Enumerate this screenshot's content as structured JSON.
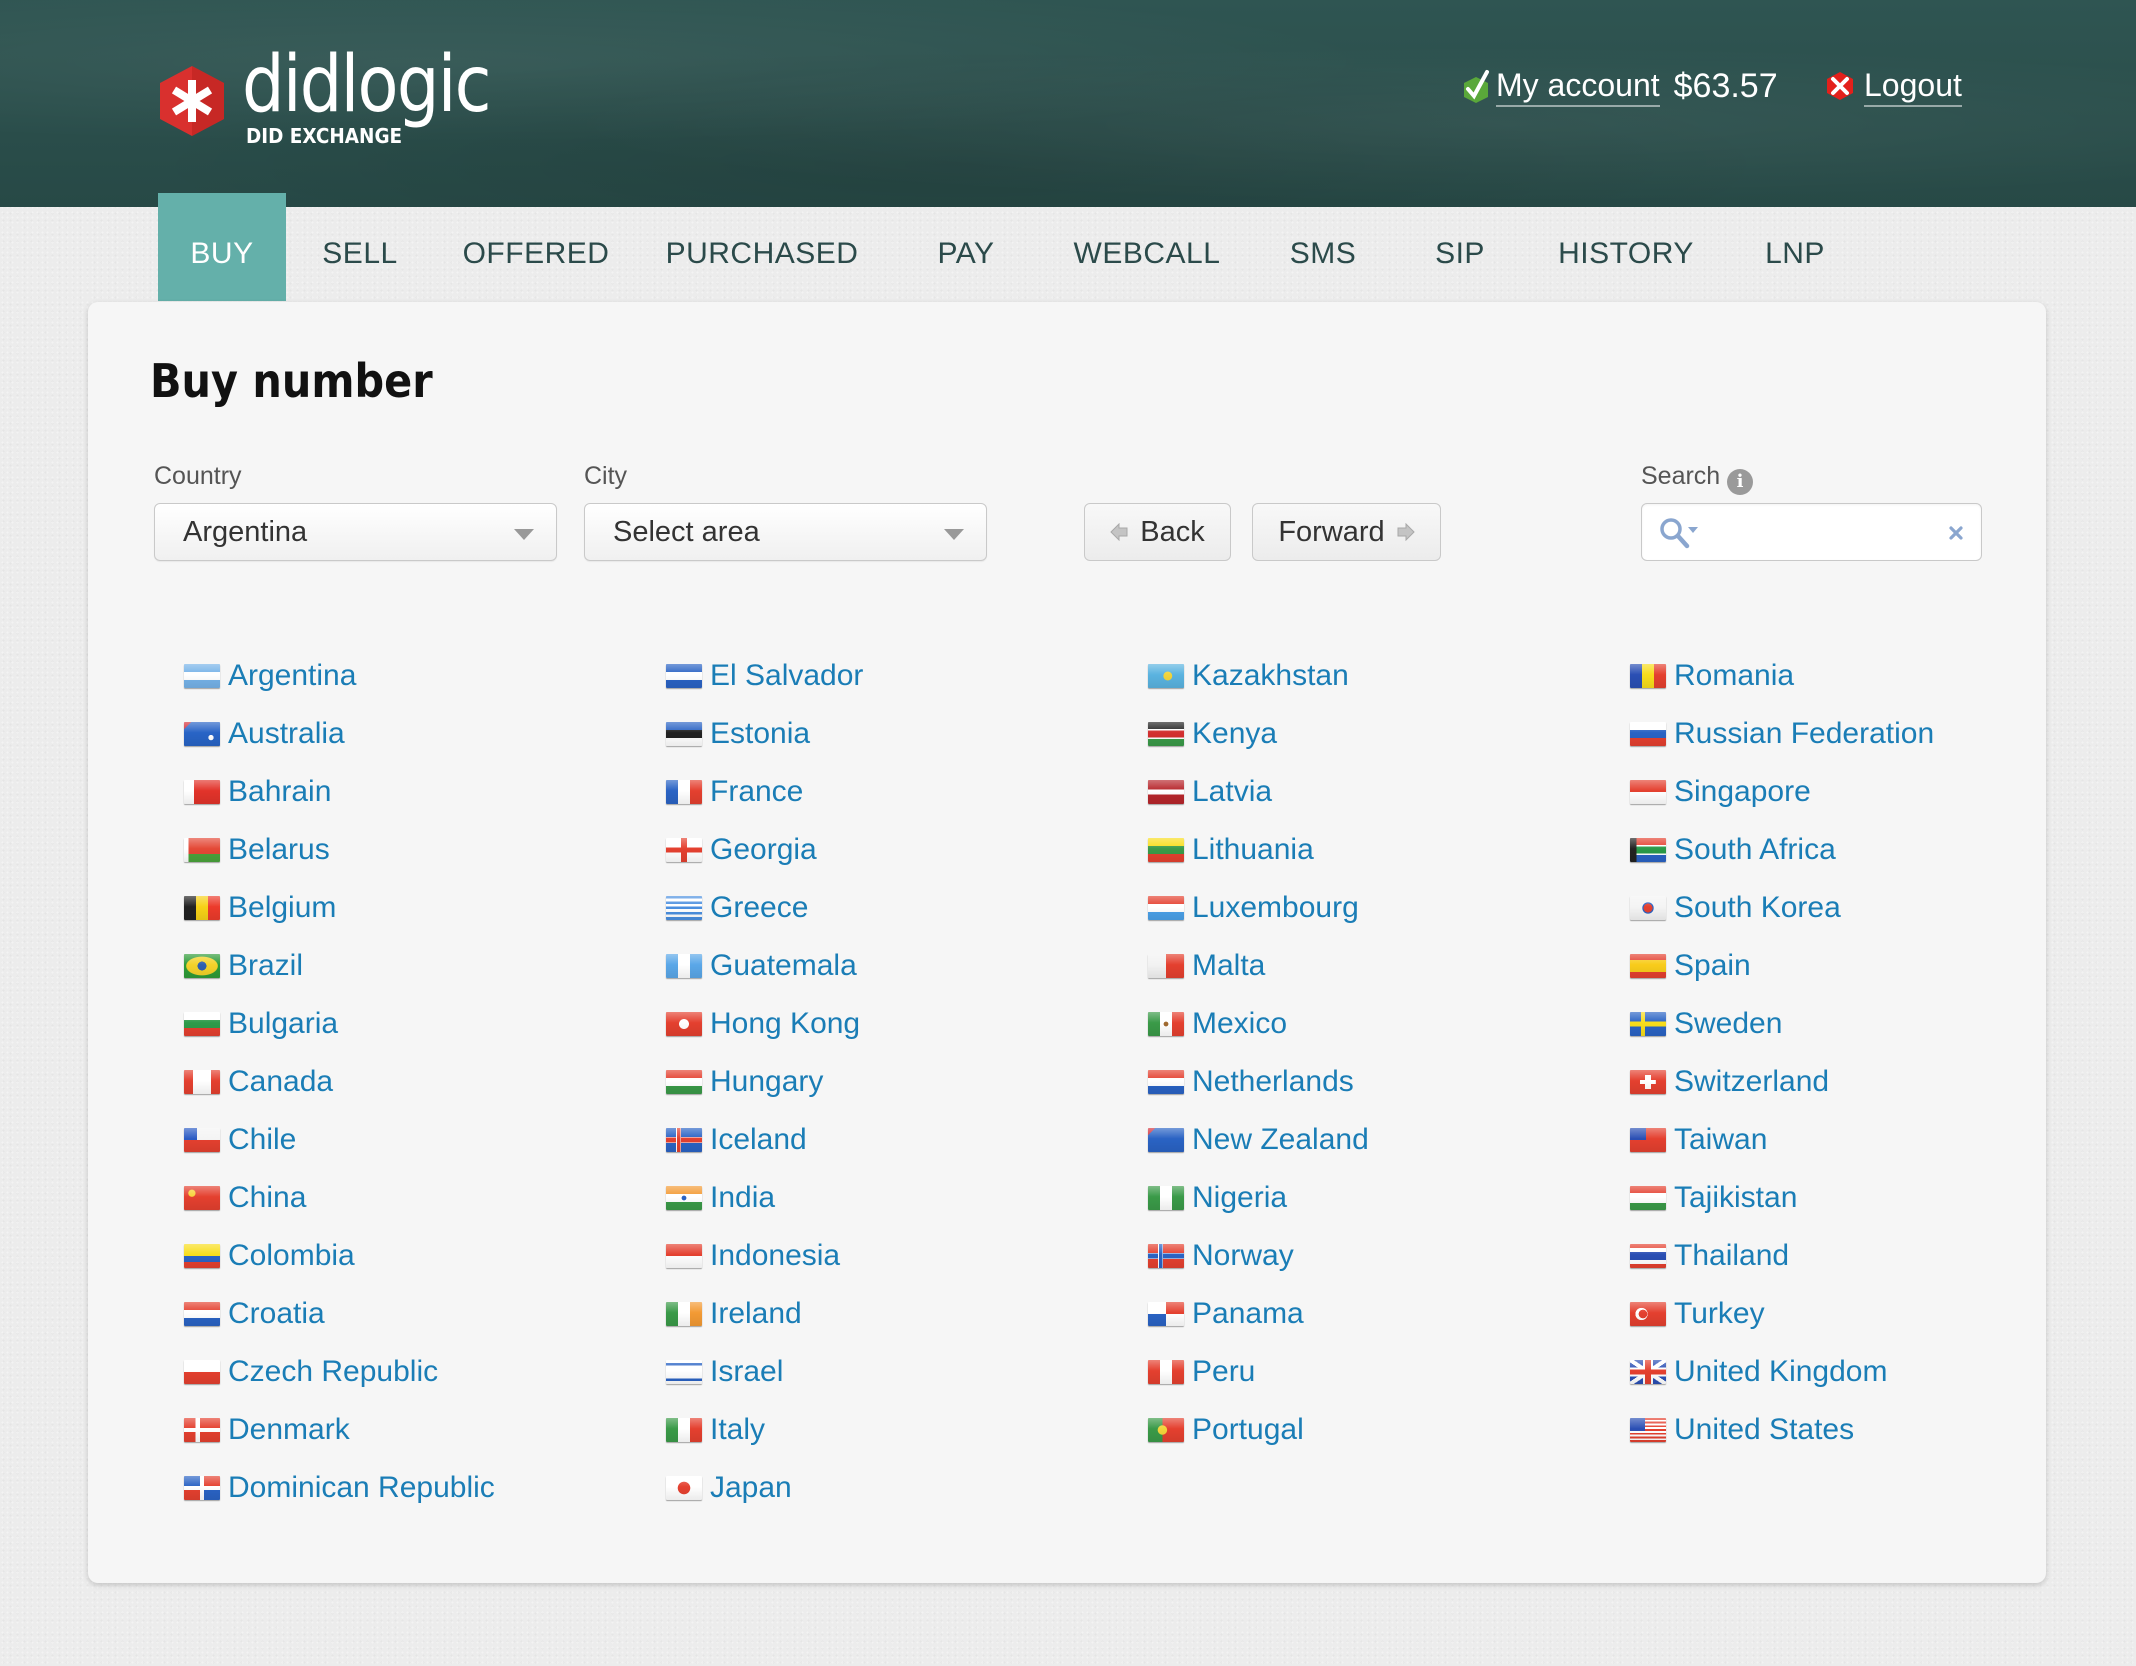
{
  "brand": {
    "name": "didlogic",
    "tagline": "DID EXCHANGE",
    "logo_icon": "asterisk-hexagon-icon",
    "colors": {
      "header_bg": "#2b4f4c",
      "accent": "#64b0aa",
      "link": "#1a7db6",
      "logo_red": "#d9302e"
    }
  },
  "account": {
    "link_label": "My account",
    "balance": "$63.57",
    "status_icon": "green-check-icon",
    "logout_label": "Logout",
    "logout_icon": "red-x-icon"
  },
  "nav": {
    "active": "BUY",
    "items": [
      {
        "label": "BUY"
      },
      {
        "label": "SELL"
      },
      {
        "label": "OFFERED"
      },
      {
        "label": "PURCHASED"
      },
      {
        "label": "PAY"
      },
      {
        "label": "WEBCALL"
      },
      {
        "label": "SMS"
      },
      {
        "label": "SIP"
      },
      {
        "label": "HISTORY"
      },
      {
        "label": "LNP"
      }
    ]
  },
  "page": {
    "title": "Buy number",
    "country_label": "Country",
    "country_value": "Argentina",
    "city_label": "City",
    "city_value": "Select area",
    "back_label": "Back",
    "forward_label": "Forward",
    "search_label": "Search",
    "search_value": "",
    "search_placeholder": ""
  },
  "countries": [
    [
      "Argentina",
      "Australia",
      "Bahrain",
      "Belarus",
      "Belgium",
      "Brazil",
      "Bulgaria",
      "Canada",
      "Chile",
      "China",
      "Colombia",
      "Croatia",
      "Czech Republic",
      "Denmark",
      "Dominican Republic"
    ],
    [
      "El Salvador",
      "Estonia",
      "France",
      "Georgia",
      "Greece",
      "Guatemala",
      "Hong Kong",
      "Hungary",
      "Iceland",
      "India",
      "Indonesia",
      "Ireland",
      "Israel",
      "Italy",
      "Japan"
    ],
    [
      "Kazakhstan",
      "Kenya",
      "Latvia",
      "Lithuania",
      "Luxembourg",
      "Malta",
      "Mexico",
      "Netherlands",
      "New Zealand",
      "Nigeria",
      "Norway",
      "Panama",
      "Peru",
      "Portugal"
    ],
    [
      "Romania",
      "Russian Federation",
      "Singapore",
      "South Africa",
      "South Korea",
      "Spain",
      "Sweden",
      "Switzerland",
      "Taiwan",
      "Tajikistan",
      "Thailand",
      "Turkey",
      "United Kingdom",
      "United States"
    ]
  ]
}
